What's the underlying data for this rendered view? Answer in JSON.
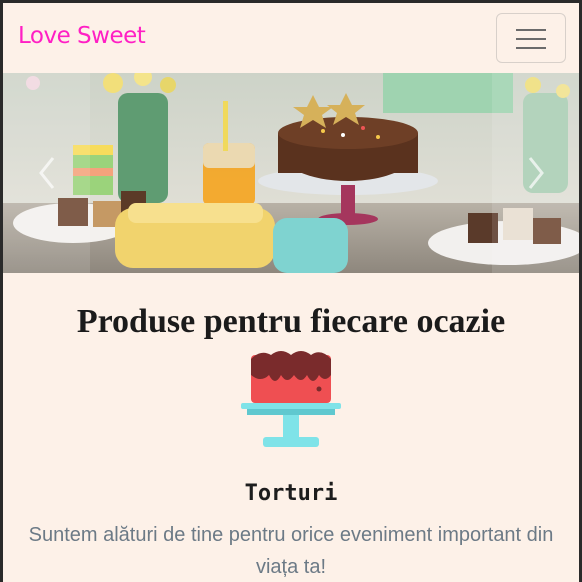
{
  "navbar": {
    "brand": "Love Sweet",
    "toggler_icon": "hamburger-icon"
  },
  "carousel": {
    "prev_icon": "chevron-left-icon",
    "next_icon": "chevron-right-icon"
  },
  "main": {
    "heading": "Produse pentru fiecare ocazie",
    "card": {
      "icon": "cake-stand-icon",
      "title": "Torturi",
      "text": "Suntem alături de tine pentru orice eveniment important din viața ta!"
    }
  },
  "colors": {
    "background": "#fdf1e8",
    "brand": "#ff1fc4",
    "text_muted": "#6c7a86"
  }
}
